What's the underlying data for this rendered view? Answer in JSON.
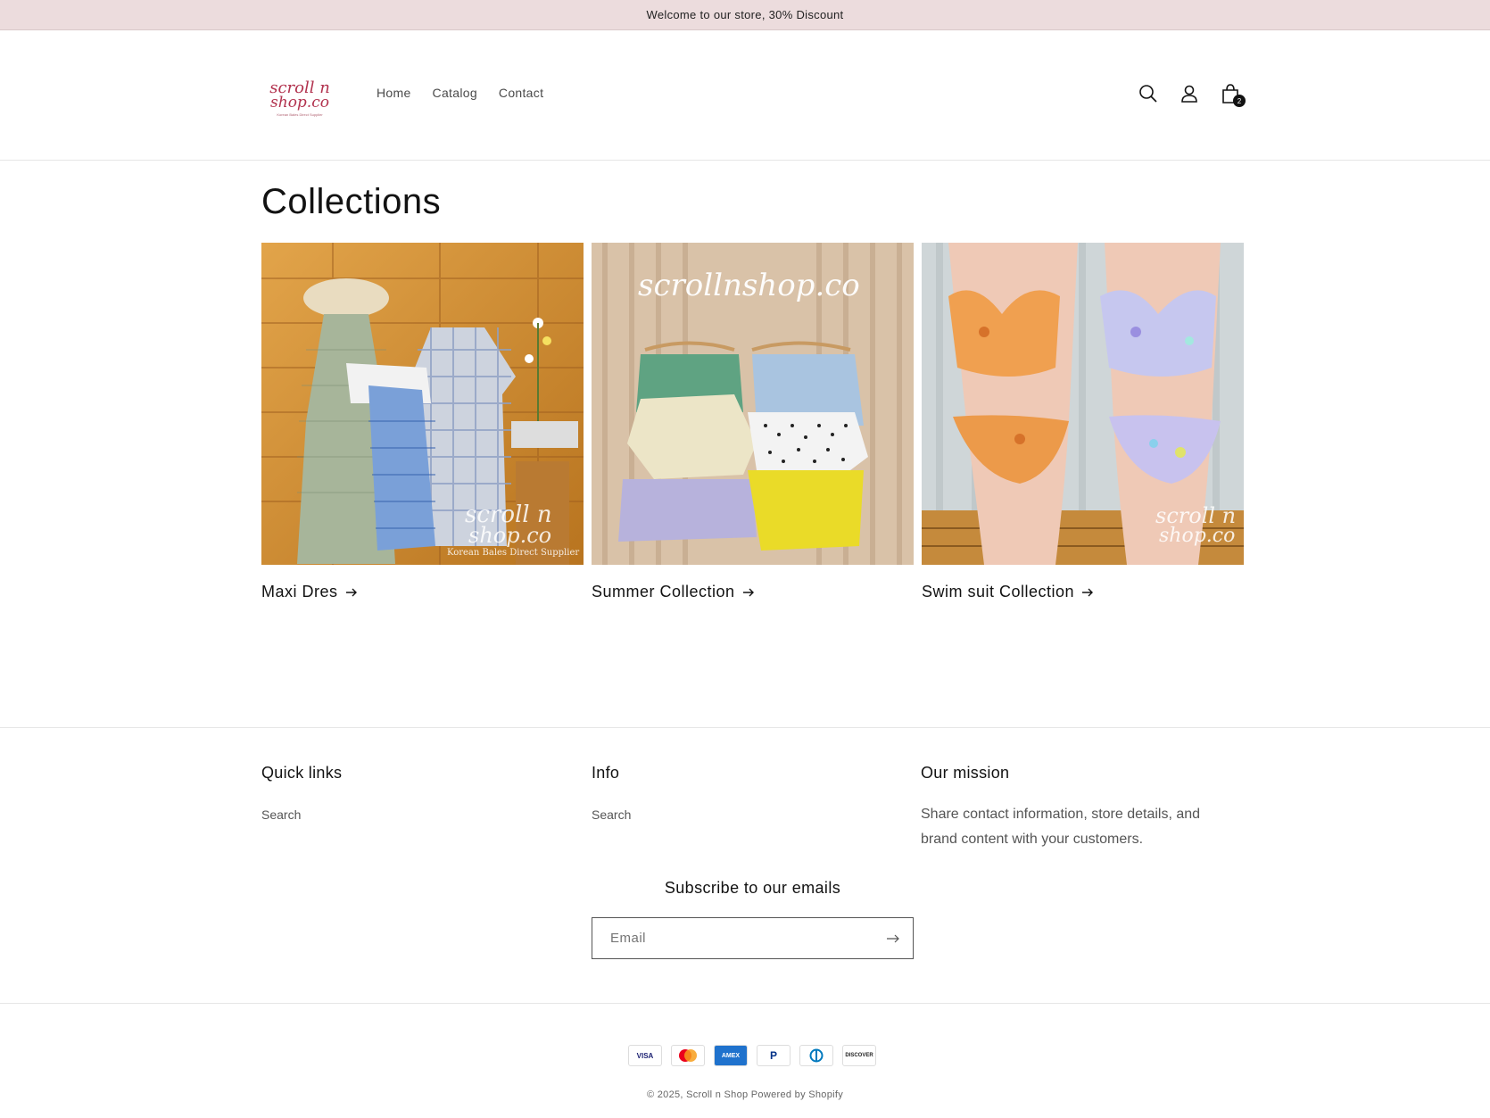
{
  "announcement": {
    "text": "Welcome to our store, 30% Discount"
  },
  "header": {
    "logo": {
      "line1": "scroll n",
      "line2": "shop.co",
      "tagline": "Korean Bales Direct Supplier"
    },
    "nav": [
      {
        "label": "Home"
      },
      {
        "label": "Catalog"
      },
      {
        "label": "Contact"
      }
    ],
    "icons": [
      "search-icon",
      "account-icon",
      "cart-icon"
    ],
    "cart_count": "2"
  },
  "main": {
    "title": "Collections",
    "collections": [
      {
        "title": "Maxi Dres",
        "watermark1": "scroll n",
        "watermark2": "shop.co",
        "watermark_sub": "Korean Bales Direct Supplier"
      },
      {
        "title": "Summer Collection",
        "watermark1": "scrollnshop.co"
      },
      {
        "title": "Swim suit Collection",
        "watermark1": "scroll n",
        "watermark2": "shop.co"
      }
    ]
  },
  "footer": {
    "quick_links": {
      "heading": "Quick links",
      "links": [
        "Search"
      ]
    },
    "info": {
      "heading": "Info",
      "links": [
        "Search"
      ]
    },
    "mission": {
      "heading": "Our mission",
      "text": "Share contact information, store details, and brand content with your customers."
    },
    "subscribe": {
      "heading": "Subscribe to our emails",
      "placeholder": "Email"
    },
    "payments": [
      "VISA",
      "MC",
      "AMEX",
      "PayPal",
      "Diners",
      "DISCOVER"
    ],
    "copyright": "© 2025, Scroll n Shop Powered by Shopify"
  },
  "colors": {
    "announcement_bg": "#ecdcdd",
    "brand": "#b2324e",
    "text": "#121212"
  }
}
